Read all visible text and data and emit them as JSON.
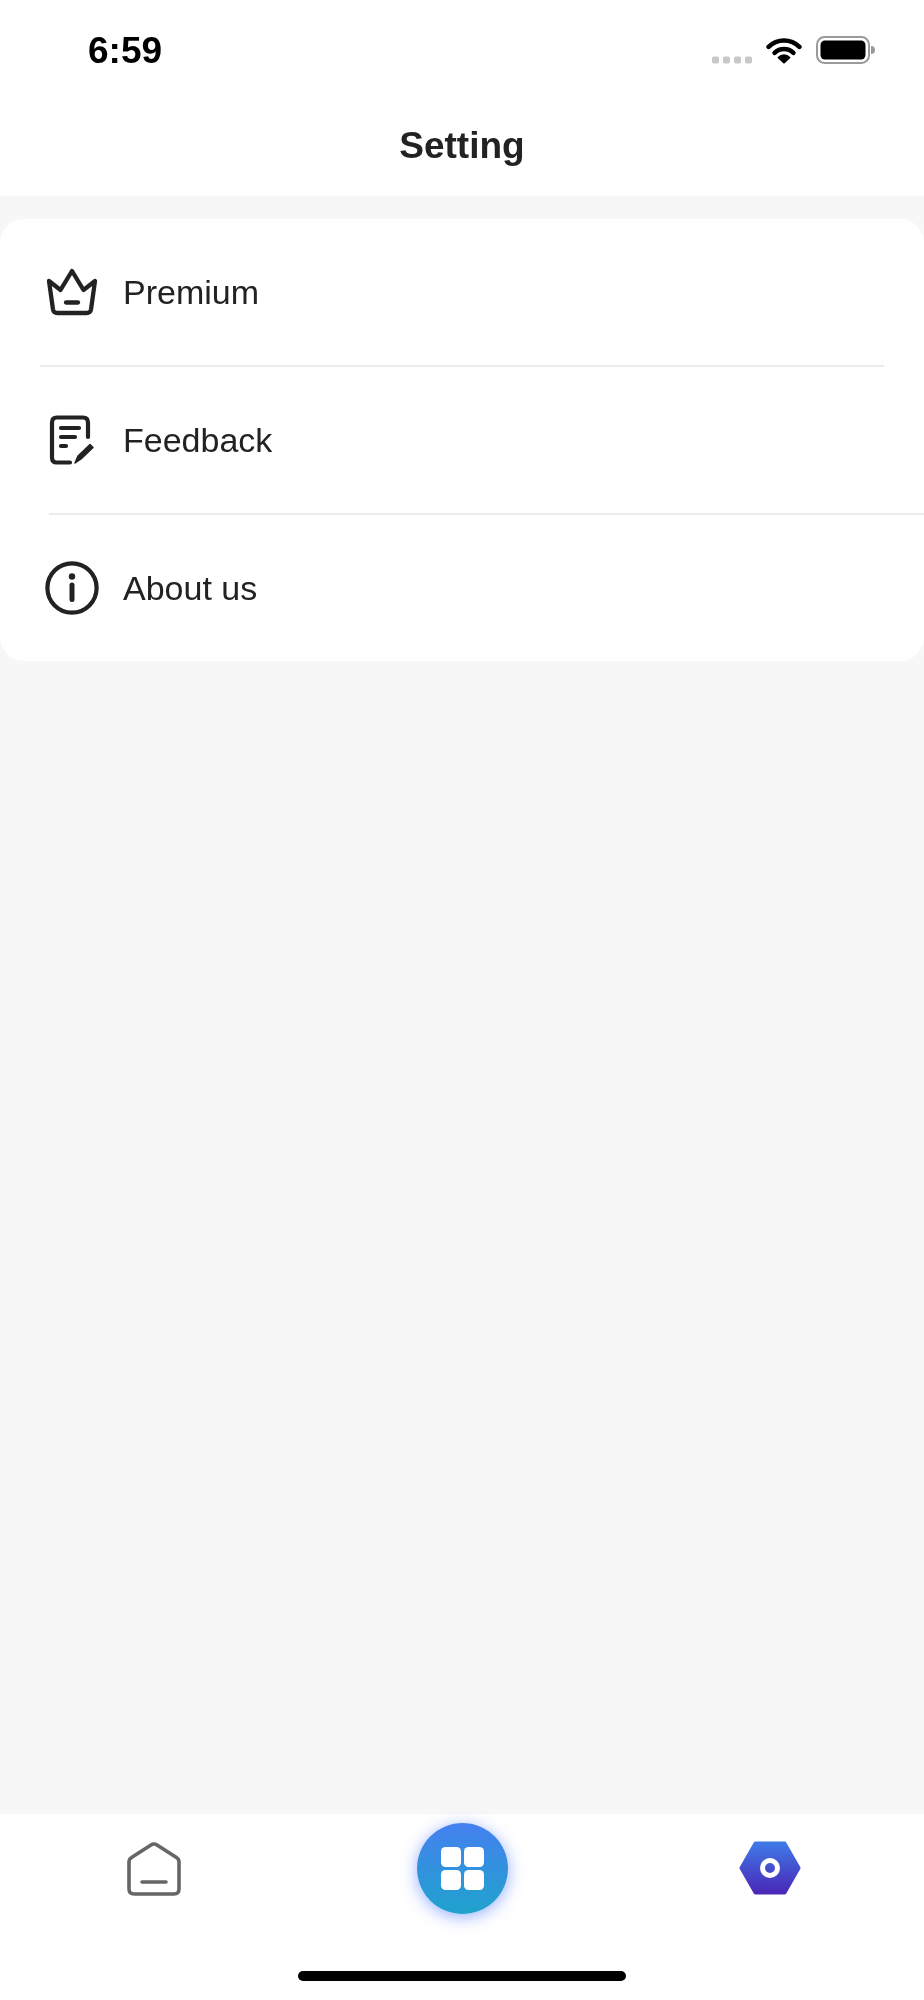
{
  "status_bar": {
    "time": "6:59"
  },
  "header": {
    "title": "Setting"
  },
  "settings_list": [
    {
      "label": "Premium"
    },
    {
      "label": "Feedback"
    },
    {
      "label": "About us"
    }
  ],
  "tab_bar": {
    "items": [
      {
        "kind": "tab",
        "selected": false
      },
      {
        "kind": "action"
      },
      {
        "kind": "tab",
        "selected": true
      }
    ]
  }
}
